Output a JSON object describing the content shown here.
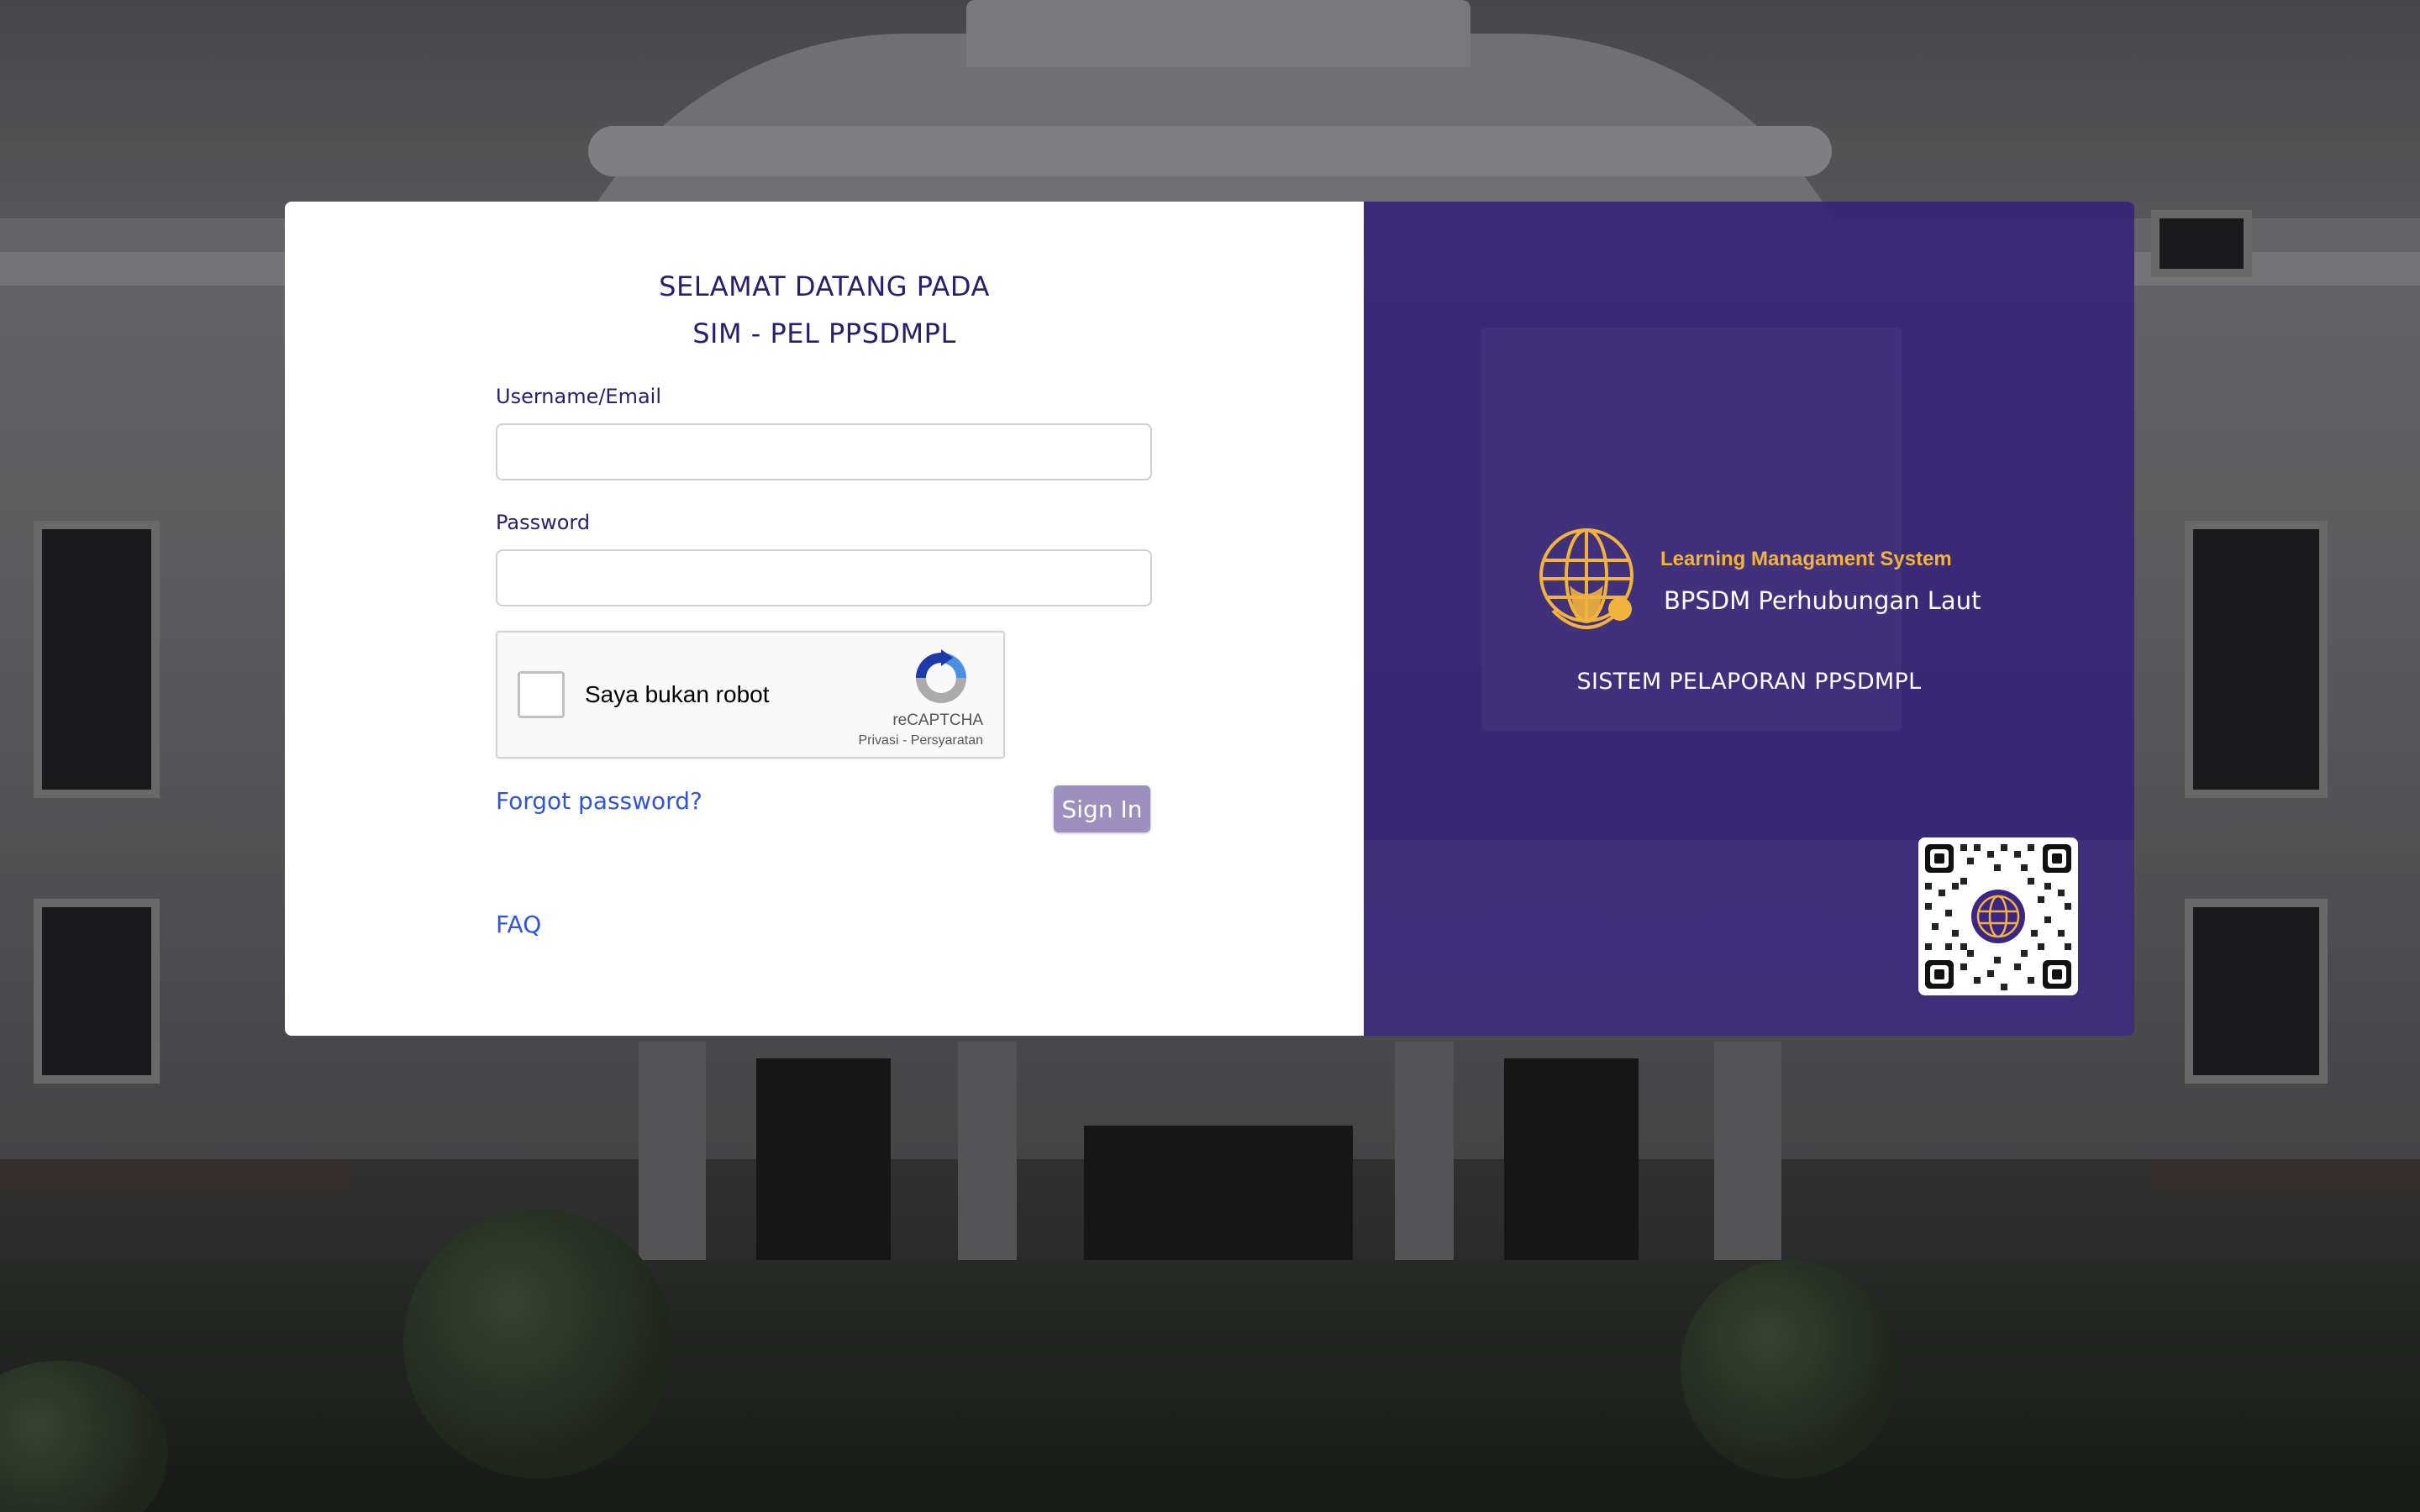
{
  "welcome": {
    "line1": "SELAMAT DATANG PADA",
    "line2": "SIM - PEL PPSDMPL"
  },
  "form": {
    "username_label": "Username/Email",
    "username_value": "",
    "password_label": "Password",
    "password_value": "",
    "forgot_link": "Forgot password?",
    "signin_label": "Sign In",
    "faq_link": "FAQ"
  },
  "recaptcha": {
    "checkbox_label": "Saya bukan robot",
    "brand": "reCAPTCHA",
    "terms": "Privasi - Persyaratan",
    "icon": "recaptcha-logo-icon"
  },
  "brand_panel": {
    "lms_title": "Learning Managament System",
    "org_name": "BPSDM Perhubungan Laut",
    "system_name": "SISTEM PELAPORAN PPSDMPL",
    "logo_icon": "globe-anchor-logo-icon",
    "qr_icon": "qr-code-icon"
  },
  "colors": {
    "primary": "#2a1e6e",
    "panel_purple": "#36237a",
    "accent_gold": "#f2b33d",
    "link_blue": "#2f56d6",
    "button": "#9d90bf"
  }
}
